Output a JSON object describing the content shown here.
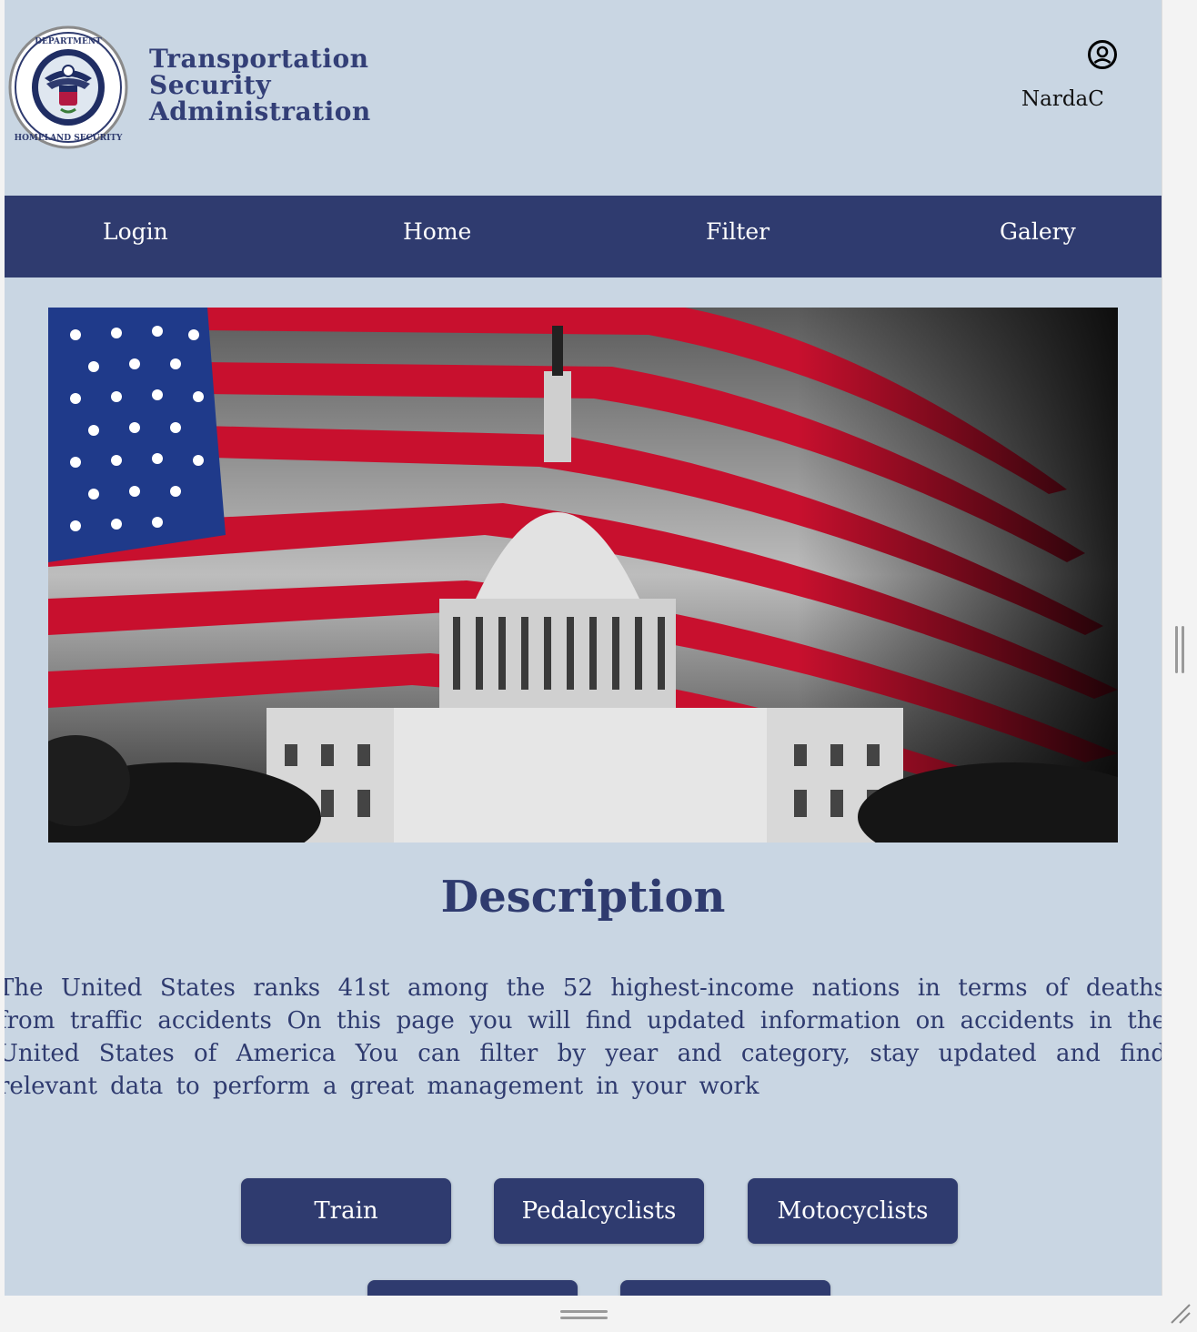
{
  "header": {
    "brand_line1": "Transportation",
    "brand_line2": "Security",
    "brand_line3": "Administration",
    "user_name": "NardaC"
  },
  "nav": {
    "items": [
      {
        "label": "Login"
      },
      {
        "label": "Home"
      },
      {
        "label": "Filter"
      },
      {
        "label": "Galery"
      }
    ]
  },
  "main": {
    "title": "Description",
    "description": "The United States ranks 41st among the 52 highest-income nations in terms of deaths from traffic accidents On this page you will find updated information on accidents in the United States of America You can filter by year and category, stay updated and find relevant data to perform a great management in your work",
    "categories": [
      {
        "label": "Train"
      },
      {
        "label": "Pedalcyclists"
      },
      {
        "label": "Motocyclists"
      },
      {
        "label": ""
      },
      {
        "label": ""
      }
    ]
  },
  "colors": {
    "page_bg": "#c9d6e3",
    "nav_bg": "#2f3b6f",
    "accent": "#2f3b6f"
  }
}
